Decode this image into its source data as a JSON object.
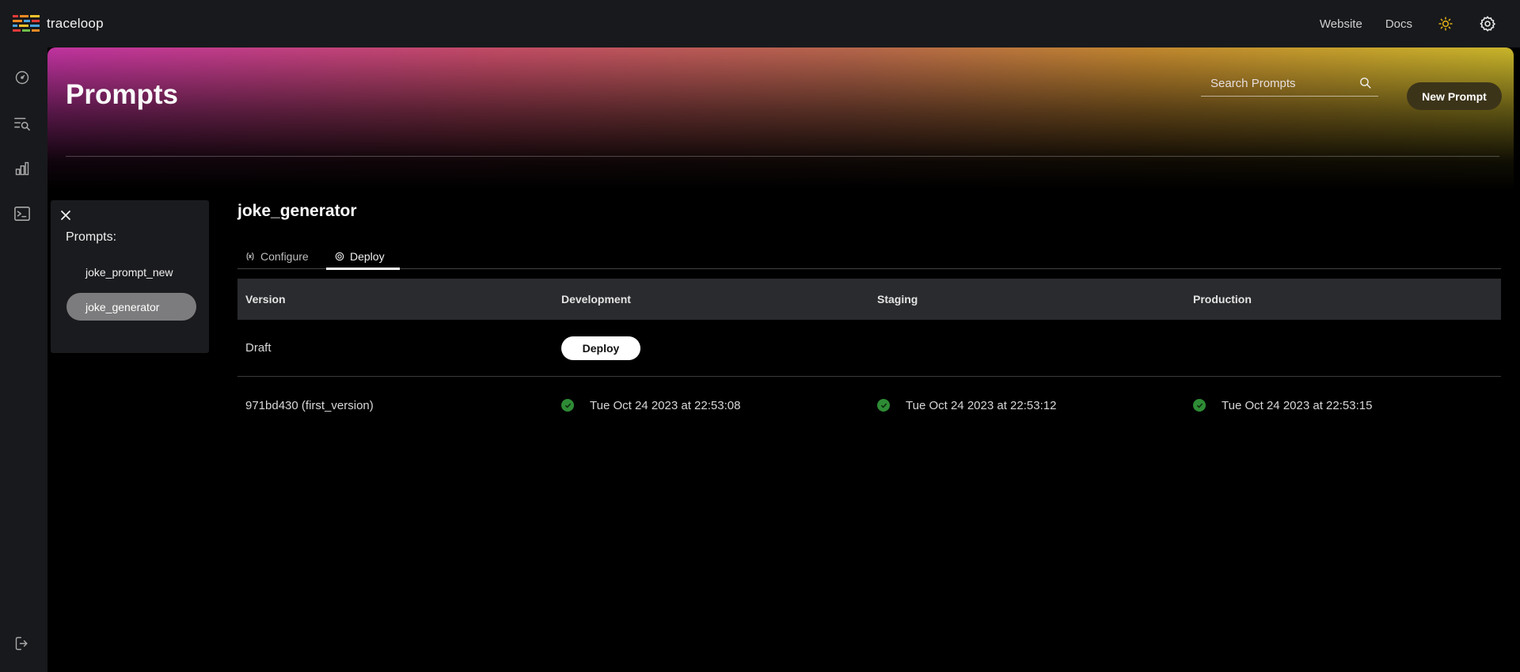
{
  "brand": {
    "name": "traceloop"
  },
  "header": {
    "website_label": "Website",
    "docs_label": "Docs"
  },
  "hero": {
    "title": "Prompts",
    "search_placeholder": "Search Prompts",
    "new_prompt_label": "New Prompt"
  },
  "panel": {
    "title": "Prompts:",
    "items": [
      {
        "label": "joke_prompt_new",
        "selected": false
      },
      {
        "label": "joke_generator",
        "selected": true
      }
    ]
  },
  "main": {
    "prompt_name": "joke_generator",
    "tabs": [
      {
        "label": "Configure",
        "active": false
      },
      {
        "label": "Deploy",
        "active": true
      }
    ],
    "table": {
      "headers": [
        "Version",
        "Development",
        "Staging",
        "Production"
      ],
      "draft_row": {
        "version": "Draft",
        "deploy_label": "Deploy"
      },
      "version_row": {
        "version": "971bd430 (first_version)",
        "development": "Tue Oct 24 2023 at 22:53:08",
        "staging": "Tue Oct 24 2023 at 22:53:12",
        "production": "Tue Oct 24 2023 at 22:53:15"
      }
    }
  },
  "colors": {
    "accent_ok": "#2e8b35",
    "hero_start": "#c0339f",
    "hero_end": "#c9b52a",
    "sun": "#e7b416"
  }
}
